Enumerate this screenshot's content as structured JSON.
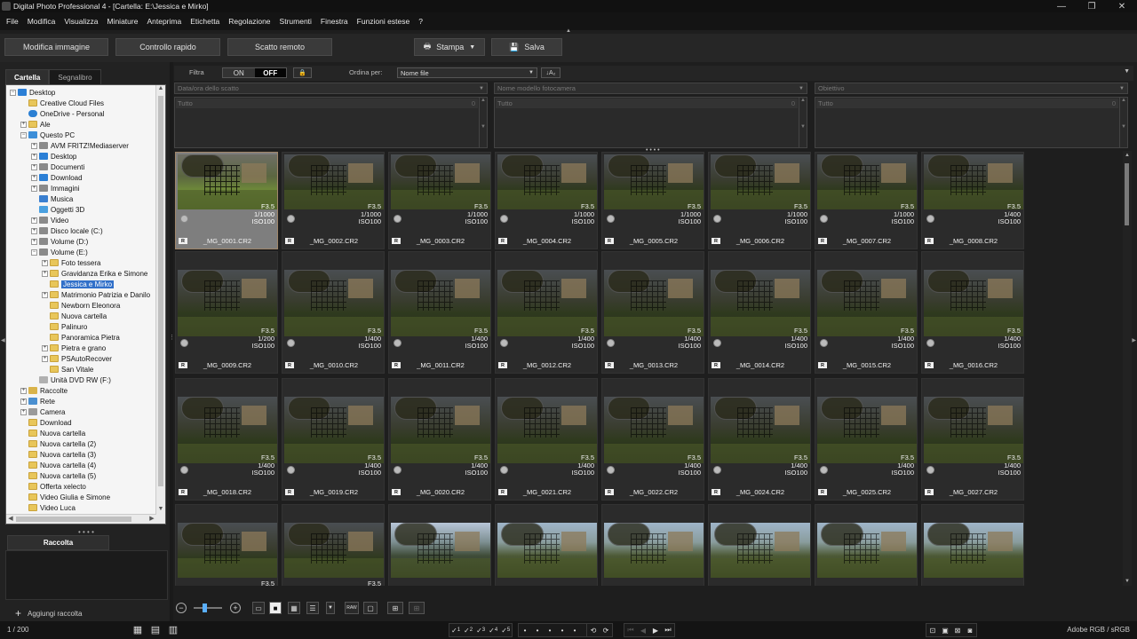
{
  "window": {
    "title": "Digital Photo Professional 4 - [Cartella: E:\\Jessica e Mirko]",
    "controls": [
      "—",
      "❐",
      "✕"
    ]
  },
  "menu": [
    "File",
    "Modifica",
    "Visualizza",
    "Miniature",
    "Anteprima",
    "Etichetta",
    "Regolazione",
    "Strumenti",
    "Finestra",
    "Funzioni estese",
    "?"
  ],
  "toolbar": {
    "edit_image": "Modifica immagine",
    "quick_check": "Controllo rapido",
    "remote_shoot": "Scatto remoto",
    "print": "Stampa",
    "save": "Salva"
  },
  "left_panel": {
    "tab_folder": "Cartella",
    "tab_bookmark": "Segnalibro",
    "tree": [
      {
        "label": "Desktop",
        "indent": 0,
        "exp": "−",
        "icon": "desk"
      },
      {
        "label": "Creative Cloud Files",
        "indent": 1,
        "exp": "",
        "icon": "folder"
      },
      {
        "label": "OneDrive - Personal",
        "indent": 1,
        "exp": "",
        "icon": "cloud"
      },
      {
        "label": "Ale",
        "indent": 1,
        "exp": "+",
        "icon": "folder"
      },
      {
        "label": "Questo PC",
        "indent": 1,
        "exp": "−",
        "icon": "pc"
      },
      {
        "label": "AVM FRITZ!Mediaserver",
        "indent": 2,
        "exp": "+",
        "icon": "drive"
      },
      {
        "label": "Desktop",
        "indent": 2,
        "exp": "+",
        "icon": "desk"
      },
      {
        "label": "Documenti",
        "indent": 2,
        "exp": "+",
        "icon": "drive"
      },
      {
        "label": "Download",
        "indent": 2,
        "exp": "+",
        "icon": "desk"
      },
      {
        "label": "Immagini",
        "indent": 2,
        "exp": "+",
        "icon": "drive"
      },
      {
        "label": "Musica",
        "indent": 2,
        "exp": "",
        "icon": "music"
      },
      {
        "label": "Oggetti 3D",
        "indent": 2,
        "exp": "",
        "icon": "obj"
      },
      {
        "label": "Video",
        "indent": 2,
        "exp": "+",
        "icon": "drive"
      },
      {
        "label": "Disco locale (C:)",
        "indent": 2,
        "exp": "+",
        "icon": "drive"
      },
      {
        "label": "Volume (D:)",
        "indent": 2,
        "exp": "+",
        "icon": "drive"
      },
      {
        "label": "Volume (E:)",
        "indent": 2,
        "exp": "−",
        "icon": "drive"
      },
      {
        "label": "Foto tessera",
        "indent": 3,
        "exp": "+",
        "icon": "folder"
      },
      {
        "label": "Gravidanza Erika e Simone",
        "indent": 3,
        "exp": "+",
        "icon": "folder"
      },
      {
        "label": "Jessica e Mirko",
        "indent": 3,
        "exp": "",
        "icon": "folder",
        "selected": true
      },
      {
        "label": "Matrimonio Patrizia e Danilo",
        "indent": 3,
        "exp": "+",
        "icon": "folder"
      },
      {
        "label": "Newborn Eleonora",
        "indent": 3,
        "exp": "",
        "icon": "folder"
      },
      {
        "label": "Nuova cartella",
        "indent": 3,
        "exp": "",
        "icon": "folder"
      },
      {
        "label": "Palinuro",
        "indent": 3,
        "exp": "",
        "icon": "folder"
      },
      {
        "label": "Panoramica Pietra",
        "indent": 3,
        "exp": "",
        "icon": "folder"
      },
      {
        "label": "Pietra e grano",
        "indent": 3,
        "exp": "+",
        "icon": "folder"
      },
      {
        "label": "PSAutoRecover",
        "indent": 3,
        "exp": "+",
        "icon": "folder"
      },
      {
        "label": "San Vitale",
        "indent": 3,
        "exp": "",
        "icon": "folder"
      },
      {
        "label": "Unità DVD RW (F:)",
        "indent": 2,
        "exp": "",
        "icon": "dvd"
      },
      {
        "label": "Raccolte",
        "indent": 1,
        "exp": "+",
        "icon": "coll"
      },
      {
        "label": "Rete",
        "indent": 1,
        "exp": "+",
        "icon": "net"
      },
      {
        "label": "Camera",
        "indent": 1,
        "exp": "+",
        "icon": "cam"
      },
      {
        "label": "Download",
        "indent": 1,
        "exp": "",
        "icon": "folder"
      },
      {
        "label": "Nuova cartella",
        "indent": 1,
        "exp": "",
        "icon": "folder"
      },
      {
        "label": "Nuova cartella (2)",
        "indent": 1,
        "exp": "",
        "icon": "folder"
      },
      {
        "label": "Nuova cartella (3)",
        "indent": 1,
        "exp": "",
        "icon": "folder"
      },
      {
        "label": "Nuova cartella (4)",
        "indent": 1,
        "exp": "",
        "icon": "folder"
      },
      {
        "label": "Nuova cartella (5)",
        "indent": 1,
        "exp": "",
        "icon": "folder"
      },
      {
        "label": "Offerta xelecto",
        "indent": 1,
        "exp": "",
        "icon": "folder"
      },
      {
        "label": "Video Giulia e Simone",
        "indent": 1,
        "exp": "",
        "icon": "folder"
      },
      {
        "label": "Video Luca",
        "indent": 1,
        "exp": "",
        "icon": "folder"
      }
    ],
    "collection_tab": "Raccolta",
    "add_collection": "Aggiungi raccolta"
  },
  "filterbar": {
    "filter_label": "Filtra",
    "on": "ON",
    "off": "OFF",
    "sort_label": "Ordina per:",
    "sort_value": "Nome file",
    "col1_header": "Data/ora dello scatto",
    "col2_header": "Nome modello fotocamera",
    "col3_header": "Obiettivo",
    "all_label": "Tutto",
    "all_count": "0"
  },
  "thumbnails": [
    {
      "name": "_MG_0001.CR2",
      "f": "F3.5",
      "s": "1/1000",
      "iso": "ISO100",
      "selected": true
    },
    {
      "name": "_MG_0002.CR2",
      "f": "F3.5",
      "s": "1/1000",
      "iso": "ISO100"
    },
    {
      "name": "_MG_0003.CR2",
      "f": "F3.5",
      "s": "1/1000",
      "iso": "ISO100"
    },
    {
      "name": "_MG_0004.CR2",
      "f": "F3.5",
      "s": "1/1000",
      "iso": "ISO100"
    },
    {
      "name": "_MG_0005.CR2",
      "f": "F3.5",
      "s": "1/1000",
      "iso": "ISO100"
    },
    {
      "name": "_MG_0006.CR2",
      "f": "F3.5",
      "s": "1/1000",
      "iso": "ISO100"
    },
    {
      "name": "_MG_0007.CR2",
      "f": "F3.5",
      "s": "1/1000",
      "iso": "ISO100"
    },
    {
      "name": "_MG_0008.CR2",
      "f": "F3.5",
      "s": "1/400",
      "iso": "ISO100"
    },
    {
      "name": "_MG_0009.CR2",
      "f": "F3.5",
      "s": "1/200",
      "iso": "ISO100"
    },
    {
      "name": "_MG_0010.CR2",
      "f": "F3.5",
      "s": "1/400",
      "iso": "ISO100"
    },
    {
      "name": "_MG_0011.CR2",
      "f": "F3.5",
      "s": "1/400",
      "iso": "ISO100"
    },
    {
      "name": "_MG_0012.CR2",
      "f": "F3.5",
      "s": "1/400",
      "iso": "ISO100"
    },
    {
      "name": "_MG_0013.CR2",
      "f": "F3.5",
      "s": "1/400",
      "iso": "ISO100"
    },
    {
      "name": "_MG_0014.CR2",
      "f": "F3.5",
      "s": "1/400",
      "iso": "ISO100"
    },
    {
      "name": "_MG_0015.CR2",
      "f": "F3.5",
      "s": "1/400",
      "iso": "ISO100"
    },
    {
      "name": "_MG_0016.CR2",
      "f": "F3.5",
      "s": "1/400",
      "iso": "ISO100"
    },
    {
      "name": "_MG_0018.CR2",
      "f": "F3.5",
      "s": "1/400",
      "iso": "ISO100"
    },
    {
      "name": "_MG_0019.CR2",
      "f": "F3.5",
      "s": "1/400",
      "iso": "ISO100"
    },
    {
      "name": "_MG_0020.CR2",
      "f": "F3.5",
      "s": "1/400",
      "iso": "ISO100"
    },
    {
      "name": "_MG_0021.CR2",
      "f": "F3.5",
      "s": "1/400",
      "iso": "ISO100"
    },
    {
      "name": "_MG_0022.CR2",
      "f": "F3.5",
      "s": "1/400",
      "iso": "ISO100"
    },
    {
      "name": "_MG_0024.CR2",
      "f": "F3.5",
      "s": "1/400",
      "iso": "ISO100"
    },
    {
      "name": "_MG_0025.CR2",
      "f": "F3.5",
      "s": "1/400",
      "iso": "ISO100"
    },
    {
      "name": "_MG_0027.CR2",
      "f": "F3.5",
      "s": "1/400",
      "iso": "ISO100"
    },
    {
      "name": "",
      "f": "F3.5",
      "s": "",
      "iso": "",
      "scene": "dark"
    },
    {
      "name": "",
      "f": "F3.5",
      "s": "",
      "iso": "",
      "scene": "dark"
    },
    {
      "name": "",
      "f": "",
      "s": "",
      "iso": "",
      "scene": "blue"
    },
    {
      "name": "",
      "f": "",
      "s": "",
      "iso": "",
      "scene": "bright"
    },
    {
      "name": "",
      "f": "",
      "s": "",
      "iso": "",
      "scene": "bright"
    },
    {
      "name": "",
      "f": "",
      "s": "",
      "iso": "",
      "scene": "bright"
    },
    {
      "name": "",
      "f": "",
      "s": "",
      "iso": "",
      "scene": "bright"
    },
    {
      "name": "",
      "f": "",
      "s": "",
      "iso": "",
      "scene": "bright"
    }
  ],
  "bottom": {
    "raw_label": "RAW"
  },
  "status": {
    "count": "1 / 200",
    "ratings": [
      "1",
      "2",
      "3",
      "4",
      "5"
    ],
    "color_space": "Adobe RGB / sRGB"
  }
}
